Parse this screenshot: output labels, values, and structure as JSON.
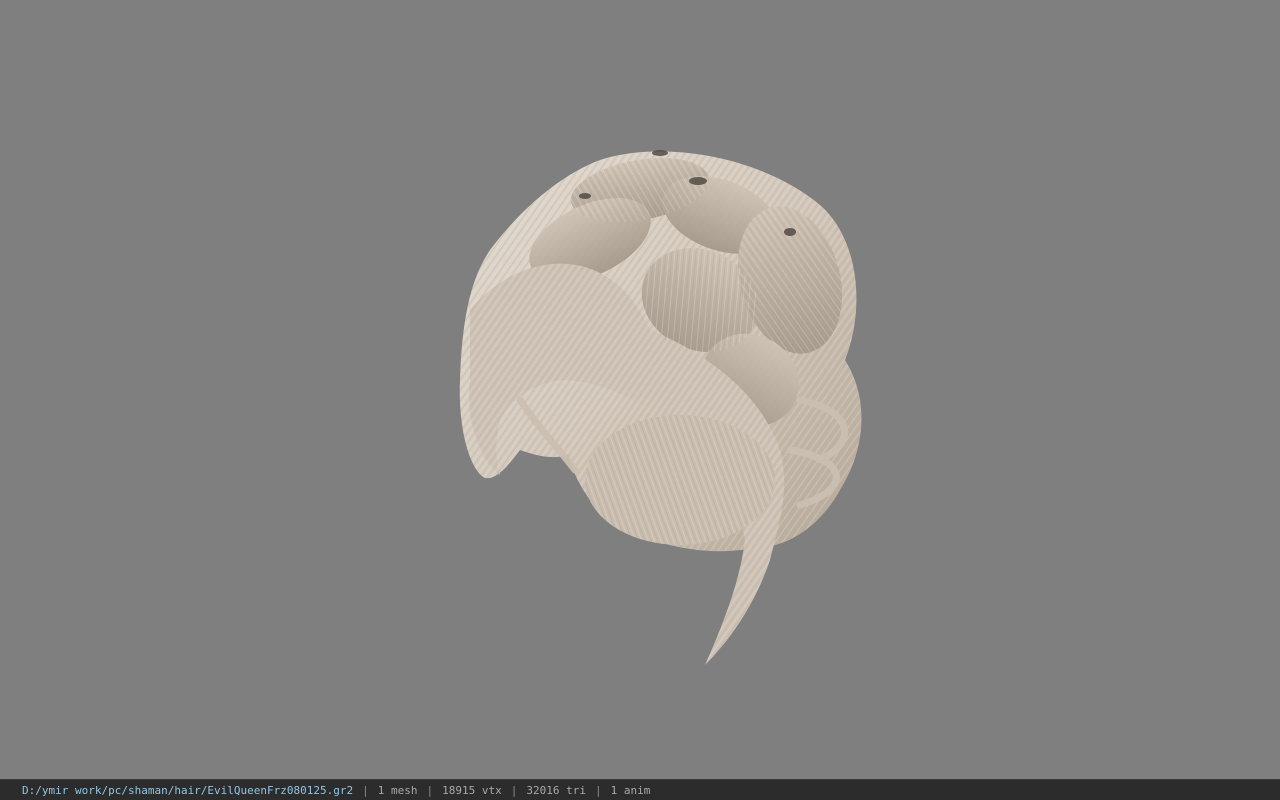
{
  "viewport": {
    "background": "#7f7f7f",
    "model": "hair-mesh",
    "hair_base_color": "#d9cfc3",
    "hair_shadow_color": "#a99d90"
  },
  "status": {
    "path": "D:/ymir work/pc/shaman/hair/EvilQueenFrz080125.gr2",
    "separator": "|",
    "mesh": "1 mesh",
    "vtx": "18915 vtx",
    "tri": "32016 tri",
    "anim": "1 anim"
  }
}
